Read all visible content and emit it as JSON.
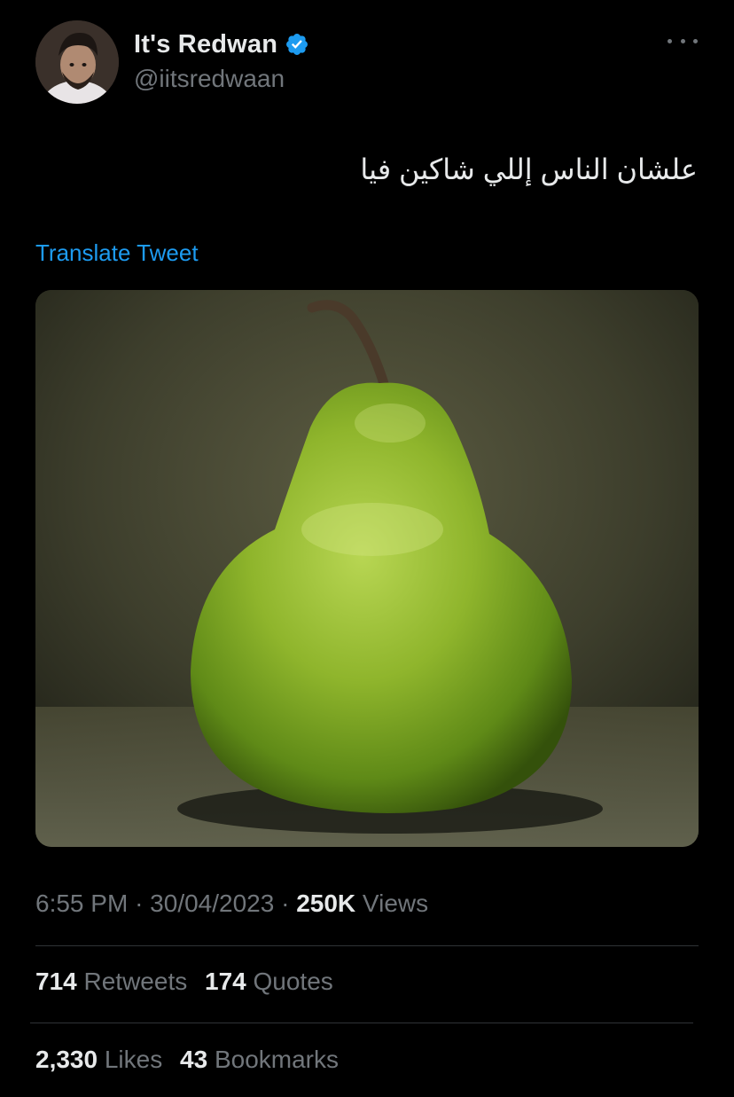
{
  "author": {
    "display_name": "It's Redwan",
    "handle": "@iitsredwaan",
    "verified": true
  },
  "tweet": {
    "text": "علشان الناس إللي شاكين فيا",
    "translate_label": "Translate Tweet",
    "image_subject": "pear-photo"
  },
  "meta": {
    "time": "6:55 PM",
    "separator": "·",
    "date": "30/04/2023",
    "views_count": "250K",
    "views_label": "Views"
  },
  "stats": {
    "retweets_count": "714",
    "retweets_label": "Retweets",
    "quotes_count": "174",
    "quotes_label": "Quotes",
    "likes_count": "2,330",
    "likes_label": "Likes",
    "bookmarks_count": "43",
    "bookmarks_label": "Bookmarks"
  },
  "colors": {
    "background": "#000000",
    "text_primary": "#e7e9ea",
    "text_secondary": "#71767b",
    "link": "#1d9bf0",
    "verified_badge": "#1d9bf0",
    "divider": "#2f3336"
  },
  "icons": {
    "verified": "verified-badge-icon",
    "more": "more-horizontal-icon"
  }
}
